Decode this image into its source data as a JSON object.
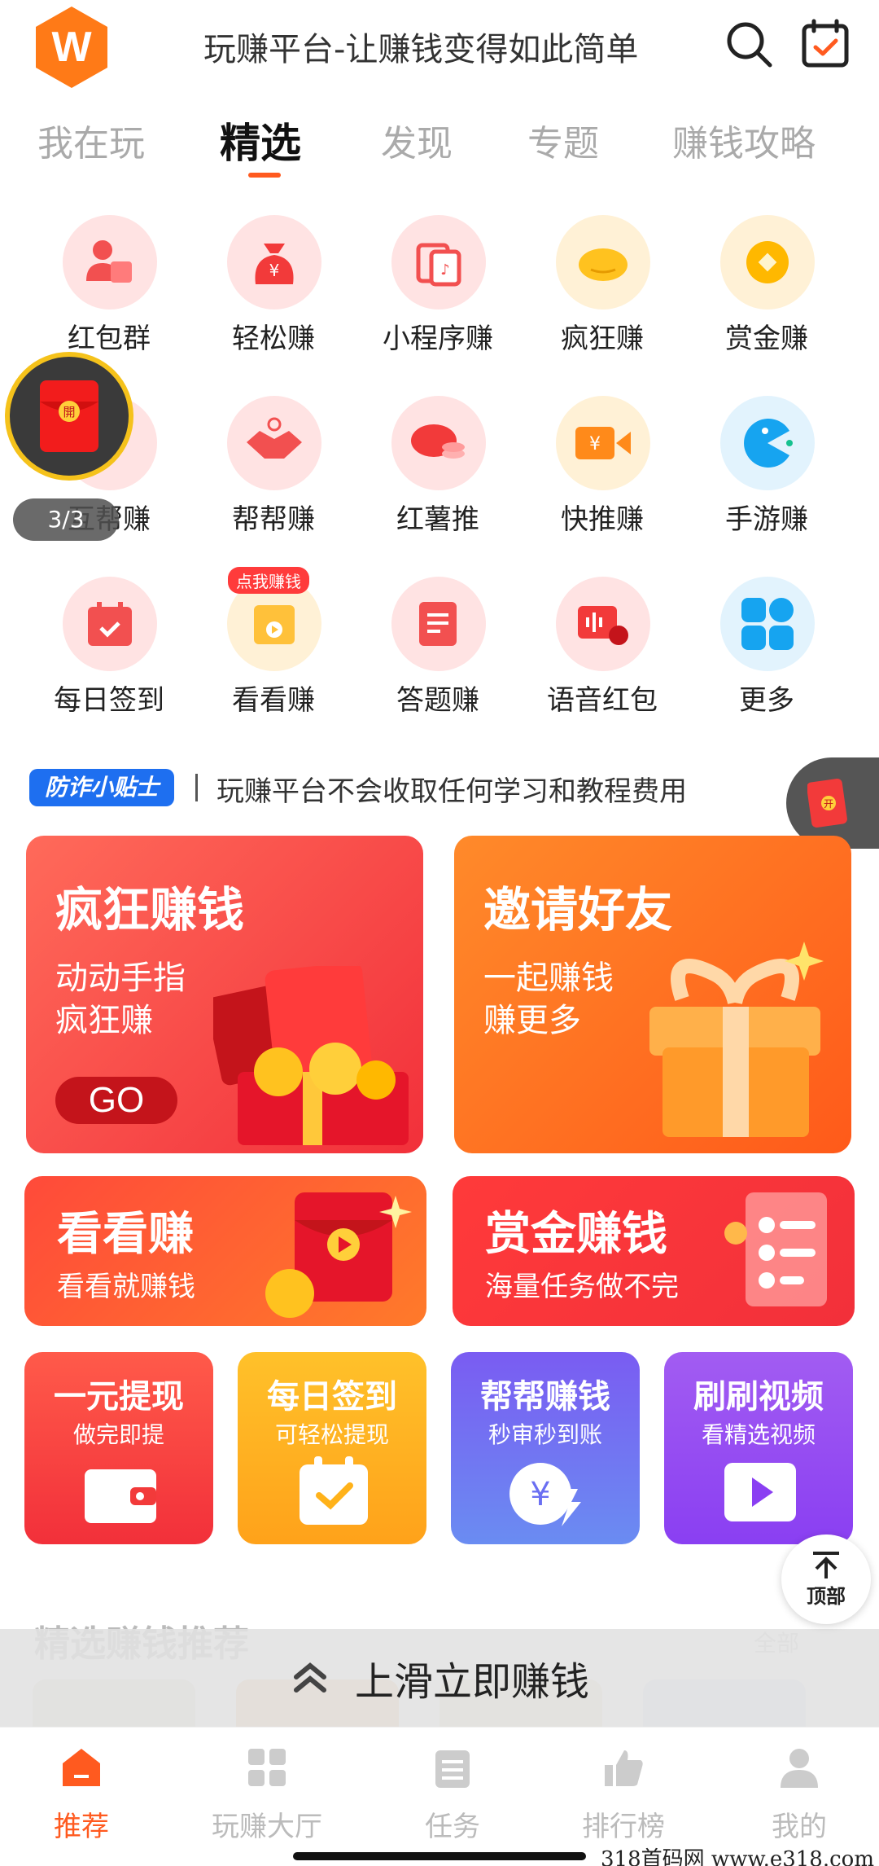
{
  "header": {
    "logo_letter": "W",
    "title": "玩赚平台-让赚钱变得如此简单"
  },
  "tabs": [
    "我在玩",
    "精选",
    "发现",
    "专题",
    "赚钱攻略"
  ],
  "active_tab": "精选",
  "grid": [
    {
      "label": "红包群"
    },
    {
      "label": "轻松赚"
    },
    {
      "label": "小程序赚"
    },
    {
      "label": "疯狂赚"
    },
    {
      "label": "赏金赚"
    },
    {
      "label": "互帮赚"
    },
    {
      "label": "帮帮赚"
    },
    {
      "label": "红薯推"
    },
    {
      "label": "快推赚"
    },
    {
      "label": "手游赚"
    },
    {
      "label": "每日签到"
    },
    {
      "label": "看看赚",
      "badge": "点我赚钱"
    },
    {
      "label": "答题赚"
    },
    {
      "label": "语音红包"
    },
    {
      "label": "更多"
    }
  ],
  "float_redpack": {
    "glyph": "開",
    "counter": "3/3"
  },
  "float_right_glyph": "开",
  "tip": {
    "badge": "防诈小贴士",
    "text": "玩赚平台不会收取任何学习和教程费用"
  },
  "banners": {
    "crazy": {
      "title": "疯狂赚钱",
      "line1": "动动手指",
      "line2": "疯狂赚",
      "button": "GO"
    },
    "invite": {
      "title": "邀请好友",
      "line1": "一起赚钱",
      "line2": "赚更多"
    },
    "watch": {
      "title": "看看赚",
      "sub": "看看就赚钱"
    },
    "bounty": {
      "title": "赏金赚钱",
      "sub": "海量任务做不完"
    }
  },
  "mini_cards": [
    {
      "title": "一元提现",
      "sub": "做完即提"
    },
    {
      "title": "每日签到",
      "sub": "可轻松提现"
    },
    {
      "title": "帮帮赚钱",
      "sub": "秒审秒到账"
    },
    {
      "title": "刷刷视频",
      "sub": "看精选视频"
    }
  ],
  "recommend": {
    "title": "精选赚钱推荐",
    "all": "全部"
  },
  "swipe_text": "上滑立即赚钱",
  "top_button": "顶部",
  "bottom_nav": [
    "推荐",
    "玩赚大厅",
    "任务",
    "排行榜",
    "我的"
  ],
  "watermark": "318首码网  www.e318.com",
  "colors": {
    "accent": "#ff5a1f",
    "red_card": "#f23a3a",
    "orange_card": "#ff6d21",
    "yellow_card": "#ffb21a",
    "blue_card": "#6a6ff2",
    "purple_card": "#9a4ff2",
    "tip_blue": "#1e6ff0"
  }
}
